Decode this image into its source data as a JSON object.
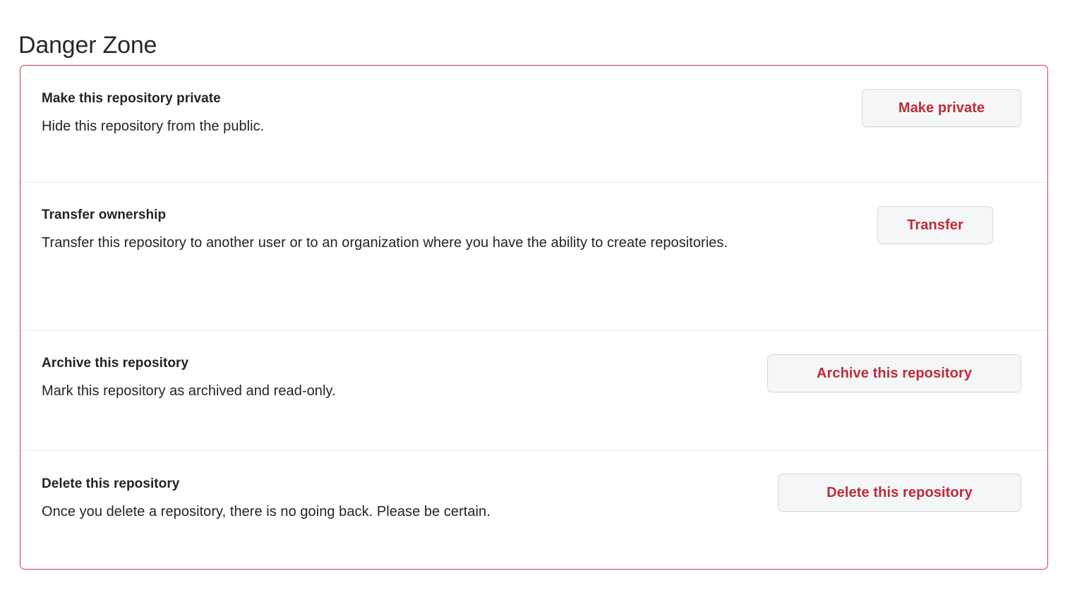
{
  "page": {
    "title": "Danger Zone"
  },
  "colors": {
    "danger_border": "#c93c4b",
    "danger_text": "#bf2b38",
    "divider": "#e8eaed",
    "button_bg": "#f4f6f8",
    "button_border": "#d6dade",
    "text": "#1f2328",
    "background": "#ffffff"
  },
  "danger_zone": {
    "rows": [
      {
        "heading": "Make this repository private",
        "description": "Hide this repository from the public.",
        "button_label": "Make private"
      },
      {
        "heading": "Transfer ownership",
        "description": "Transfer this repository to another user or to an organization where you have the ability to create repositories.",
        "button_label": "Transfer"
      },
      {
        "heading": "Archive this repository",
        "description": "Mark this repository as archived and read-only.",
        "button_label": "Archive this repository"
      },
      {
        "heading": "Delete this repository",
        "description": "Once you delete a repository, there is no going back. Please be certain.",
        "button_label": "Delete this repository"
      }
    ]
  }
}
